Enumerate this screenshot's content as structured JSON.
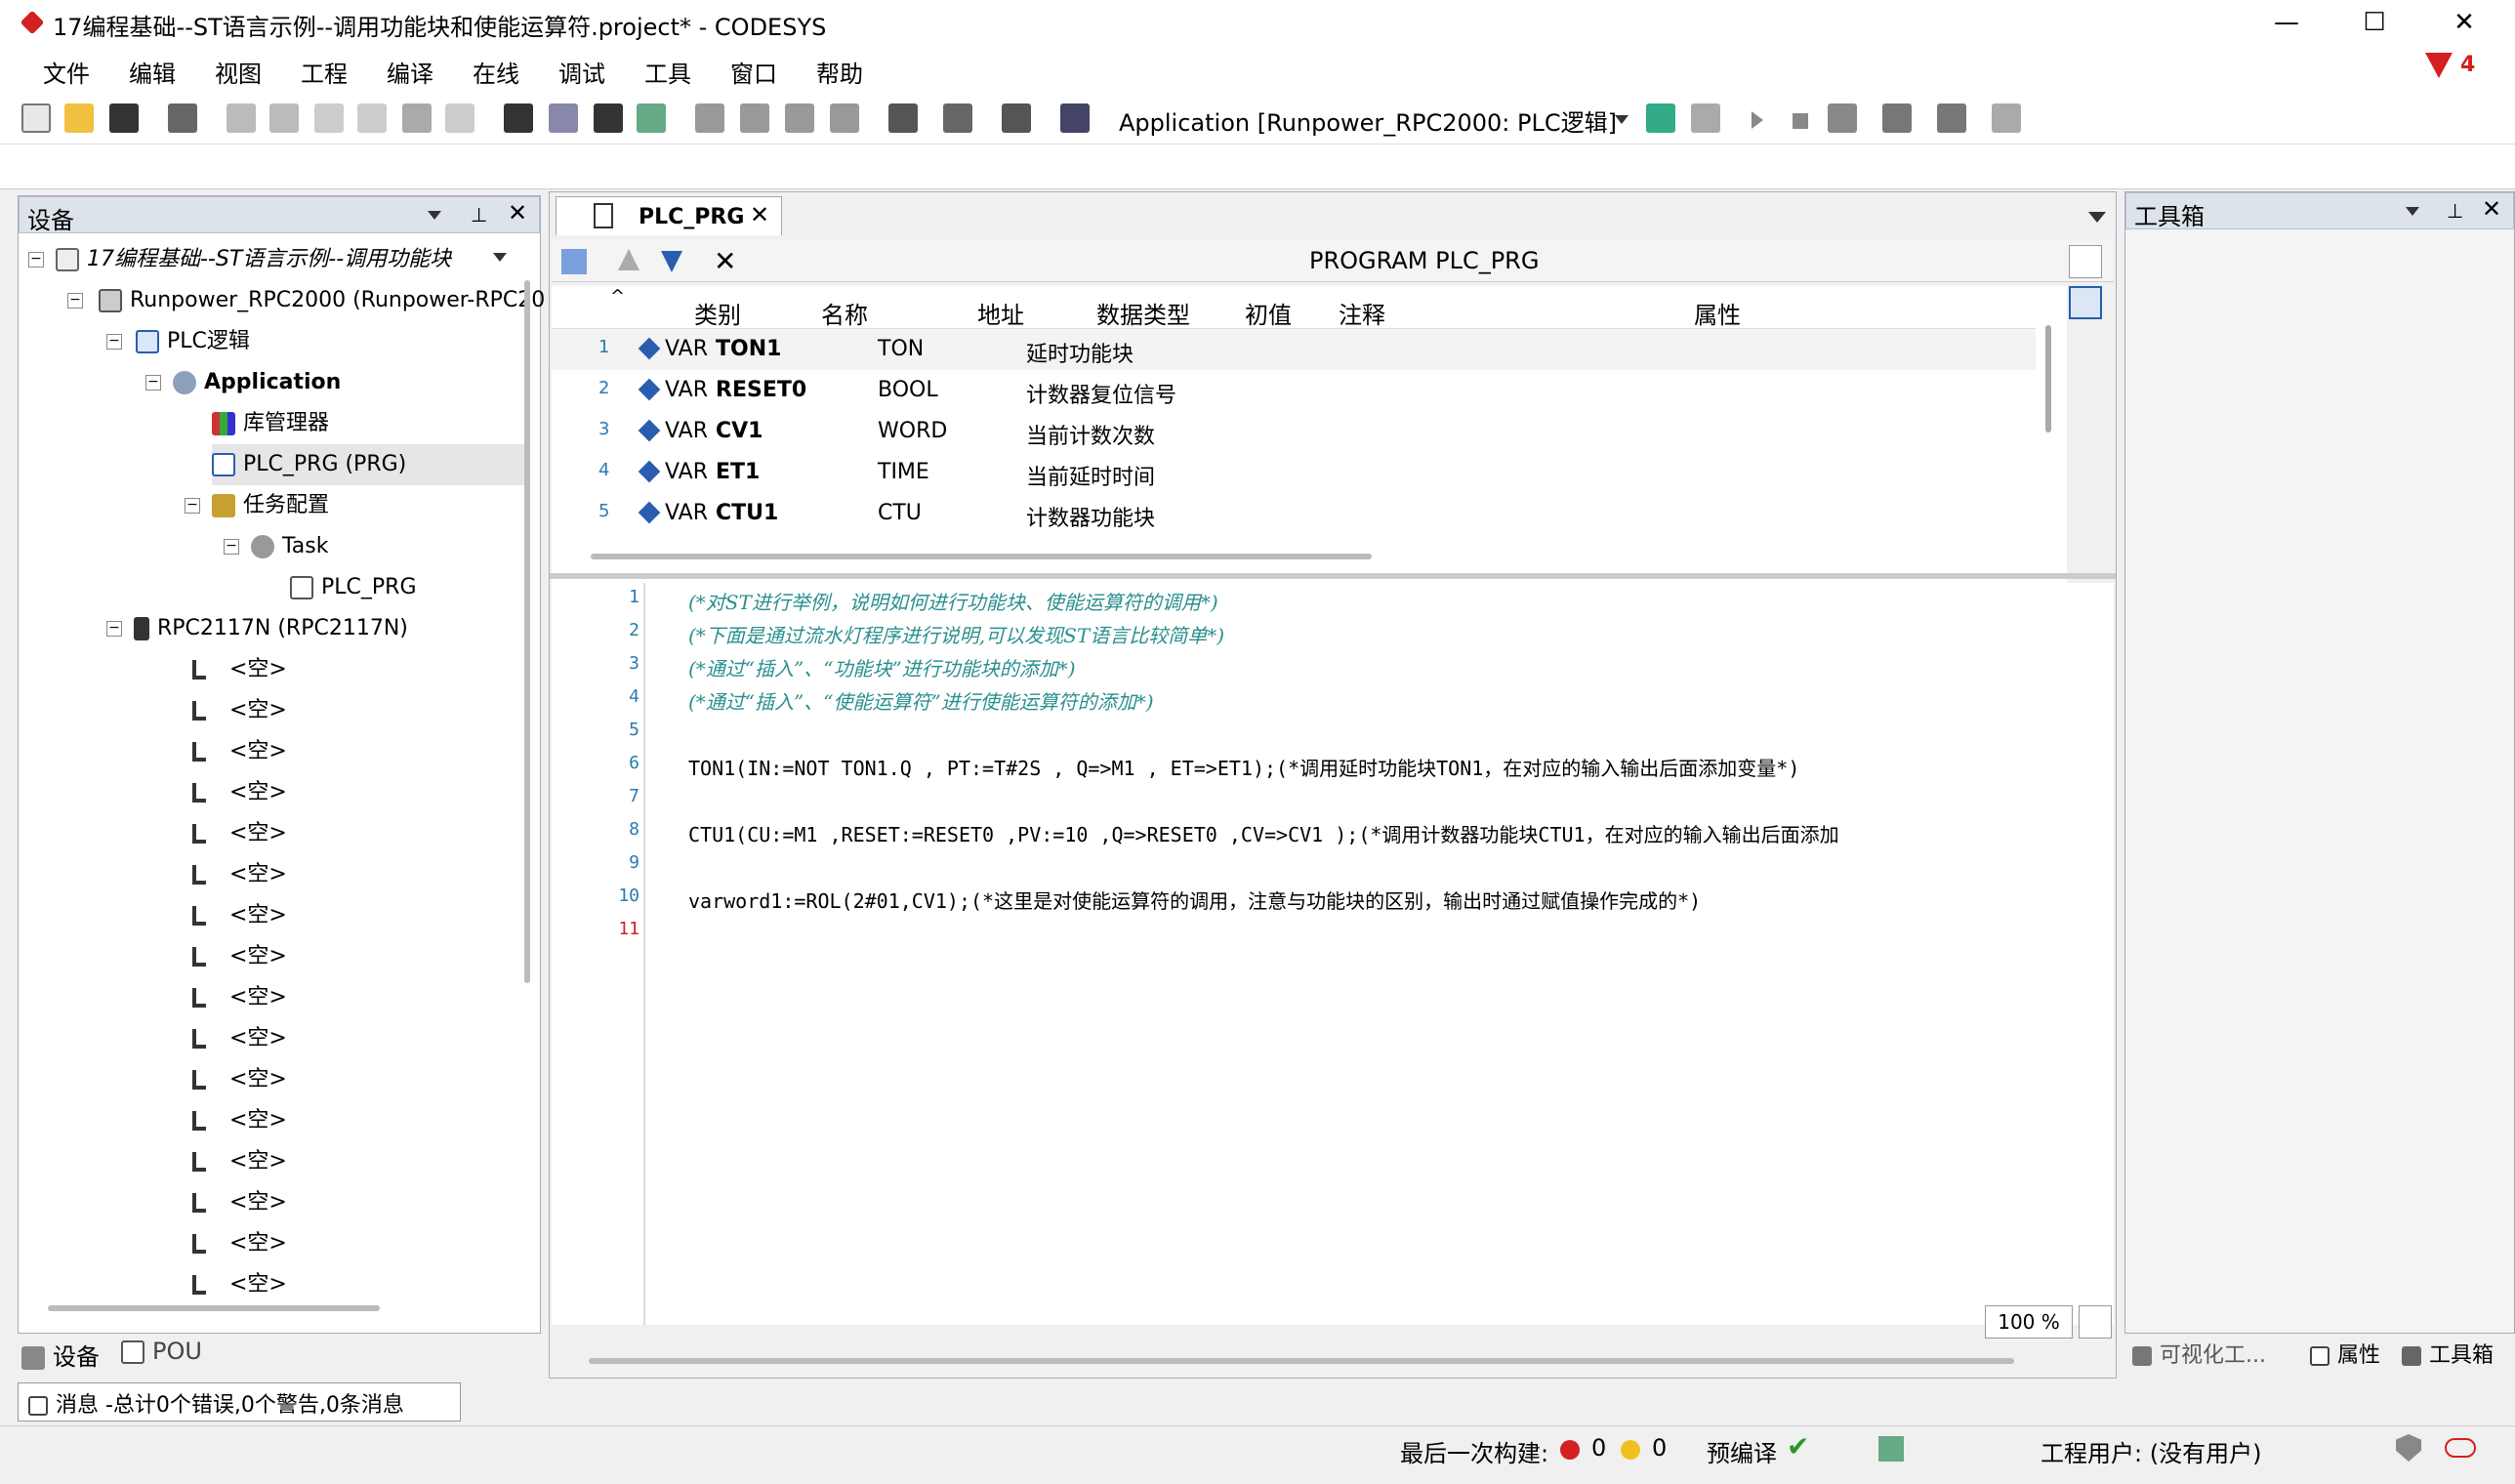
{
  "window": {
    "title": "17编程基础--ST语言示例--调用功能块和使能运算符.project* - CODESYS",
    "minimize": "—",
    "maximize": "☐",
    "close": "✕"
  },
  "menu": [
    "文件",
    "编辑",
    "视图",
    "工程",
    "编译",
    "在线",
    "调试",
    "工具",
    "窗口",
    "帮助"
  ],
  "alert_count": "4",
  "toolbar": {
    "app_selector": "Application [Runpower_RPC2000: PLC逻辑]"
  },
  "devices_panel": {
    "title": "设备",
    "tree": [
      {
        "label": "17编程基础--ST语言示例--调用功能块",
        "italic": true
      },
      {
        "label": "Runpower_RPC2000 (Runpower-RPC20"
      },
      {
        "label": "PLC逻辑"
      },
      {
        "label": "Application"
      },
      {
        "label": "库管理器"
      },
      {
        "label": "PLC_PRG (PRG)"
      },
      {
        "label": "任务配置"
      },
      {
        "label": "Task"
      },
      {
        "label": "PLC_PRG"
      },
      {
        "label": "RPC2117N (RPC2117N)"
      }
    ],
    "empty_slot_label": "<空>",
    "empty_slot_count": 16
  },
  "editor": {
    "tab_label": "PLC_PRG",
    "program_header": "PROGRAM PLC_PRG",
    "columns": [
      "类别",
      "名称",
      "地址",
      "数据类型",
      "初值",
      "注释",
      "属性"
    ],
    "rows": [
      {
        "num": "1",
        "cat": "VAR",
        "name": "TON1",
        "type": "TON",
        "comment": "延时功能块"
      },
      {
        "num": "2",
        "cat": "VAR",
        "name": "RESET0",
        "type": "BOOL",
        "comment": "计数器复位信号"
      },
      {
        "num": "3",
        "cat": "VAR",
        "name": "CV1",
        "type": "WORD",
        "comment": "当前计数次数"
      },
      {
        "num": "4",
        "cat": "VAR",
        "name": "ET1",
        "type": "TIME",
        "comment": "当前延时时间"
      },
      {
        "num": "5",
        "cat": "VAR",
        "name": "CTU1",
        "type": "CTU",
        "comment": "计数器功能块"
      }
    ],
    "code_lines": [
      "(*对ST进行举例，说明如何进行功能块、使能运算符的调用*)",
      "(*下面是通过流水灯程序进行说明,可以发现ST语言比较简单*)",
      "(*通过“插入”、“功能块”进行功能块的添加*)",
      "(*通过“插入”、“使能运算符”进行使能运算符的添加*)",
      "",
      "TON1(IN:=NOT TON1.Q , PT:=T#2S , Q=>M1 , ET=>ET1);(*调用延时功能块TON1，在对应的输入输出后面添加变量*)",
      "",
      "CTU1(CU:=M1 ,RESET:=RESET0 ,PV:=10 ,Q=>RESET0 ,CV=>CV1 );(*调用计数器功能块CTU1，在对应的输入输出后面添加",
      "",
      "varword1:=ROL(2#01,CV1);(*这里是对使能运算符的调用，注意与功能块的区别，输出时通过赋值操作完成的*)",
      ""
    ],
    "zoom": "100 %"
  },
  "toolbox_panel": {
    "title": "工具箱"
  },
  "bottom_tabs": {
    "devices": "设备",
    "pou": "POU",
    "visual": "可视化工...",
    "properties": "属性",
    "toolbox": "工具箱"
  },
  "messages": "消息 -总计0个错误,0个警告,0条消息",
  "status": {
    "last_build": "最后一次构建:",
    "errors": "0",
    "warnings": "0",
    "precompile": "预编译",
    "user": "工程用户: (没有用户)"
  }
}
